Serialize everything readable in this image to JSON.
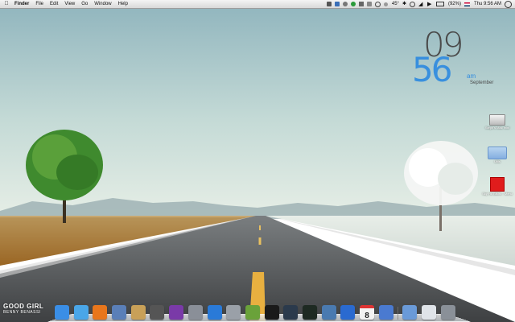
{
  "menubar": {
    "apple_icon": "apple-icon",
    "app_name": "Finder",
    "menus": [
      "File",
      "Edit",
      "View",
      "Go",
      "Window",
      "Help"
    ],
    "temperature": "45°",
    "battery": "(92%)",
    "datetime": "Thu 9:56 AM"
  },
  "clock": {
    "hour": "09",
    "minute": "56",
    "ampm": "am",
    "month": "September"
  },
  "desktop_icons": [
    {
      "label": "Steph's Mac mini",
      "icon": "hard-drive-icon"
    },
    {
      "label": "Utils",
      "icon": "folder-icon"
    },
    {
      "label": "Sky Hd Bistro - Menu",
      "icon": "pdf-icon"
    }
  ],
  "now_playing": {
    "title": "GOOD GIRL",
    "artist": "BENNY BENASSI"
  },
  "dock": {
    "apps": [
      {
        "name": "Finder",
        "icon": "finder-icon",
        "color": "#3a8ee6"
      },
      {
        "name": "Safari",
        "icon": "safari-icon",
        "color": "#4aa6e8"
      },
      {
        "name": "Firefox",
        "icon": "firefox-icon",
        "color": "#e8761c"
      },
      {
        "name": "Xcode",
        "icon": "xcode-icon",
        "color": "#5a7fb8"
      },
      {
        "name": "Archive Utility",
        "icon": "archive-icon",
        "color": "#c8a058"
      },
      {
        "name": "Eject",
        "icon": "eject-icon",
        "color": "#555555"
      },
      {
        "name": "Adium",
        "icon": "adium-icon",
        "color": "#7a3aa8"
      },
      {
        "name": "Rocket",
        "icon": "rocket-icon",
        "color": "#8a8f98"
      },
      {
        "name": "iTunes",
        "icon": "itunes-icon",
        "color": "#2a7ad8"
      },
      {
        "name": "Utility",
        "icon": "utility-icon",
        "color": "#9aa0a8"
      },
      {
        "name": "Minecraft",
        "icon": "minecraft-icon",
        "color": "#6aa23a"
      },
      {
        "name": "Terminal",
        "icon": "terminal-icon",
        "color": "#1a1a1a"
      },
      {
        "name": "Lightroom",
        "icon": "lightroom-icon",
        "color": "#2b3a4c"
      },
      {
        "name": "Activity Monitor",
        "icon": "activity-monitor-icon",
        "color": "#1e2a22"
      },
      {
        "name": "Network",
        "icon": "network-icon",
        "color": "#4a7ab0"
      },
      {
        "name": "Word",
        "icon": "word-icon",
        "color": "#2a6ad0"
      },
      {
        "name": "iCal",
        "icon": "calendar-icon",
        "color": "#f2f2f2",
        "text": "8"
      },
      {
        "name": "Xcode Tools",
        "icon": "tools-icon",
        "color": "#4a7ad0"
      },
      {
        "name": "Preview",
        "icon": "preview-icon",
        "color": "#6a9ad8"
      },
      {
        "name": "Documents",
        "icon": "documents-icon",
        "color": "#dfe3e8"
      },
      {
        "name": "Trash",
        "icon": "trash-icon",
        "color": "#8a9098"
      }
    ]
  },
  "colors": {
    "sky_top": "#8fb4bd",
    "sky_horizon": "#dbe8e2",
    "field_gold": "#a8742e",
    "road": "#4a4c4f",
    "clock_blue": "#2f8be0"
  }
}
